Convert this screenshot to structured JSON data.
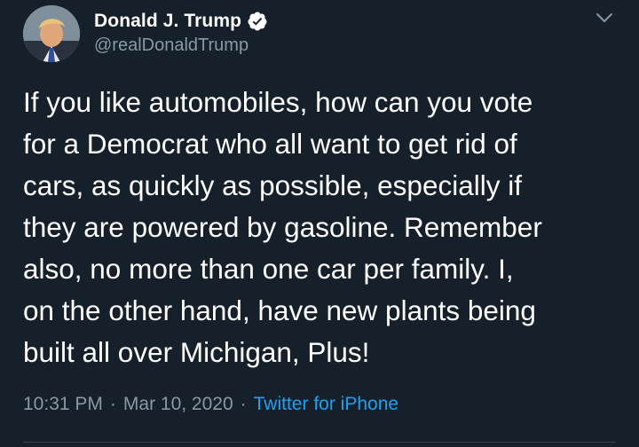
{
  "author": {
    "display_name": "Donald J. Trump",
    "handle": "@realDonaldTrump",
    "verified": true,
    "verified_icon": "verified-badge-icon",
    "avatar": "profile-avatar"
  },
  "tweet": {
    "text": "If you like automobiles, how can you vote\nfor a Democrat who all want to get rid of\ncars, as quickly as possible, especially if\nthey are powered by gasoline. Remember\nalso, no more than one car per family. I,\non the other hand, have new plants being\nbuilt all over Michigan, Plus!",
    "time": "10:31 PM",
    "date": "Mar 10, 2020",
    "separator": "·",
    "source": "Twitter for iPhone"
  },
  "menu": {
    "icon": "chevron-down-icon"
  },
  "colors": {
    "background": "#15202b",
    "text": "#ffffff",
    "secondary_text": "#8899a6",
    "accent": "#1da1f2",
    "divider": "#38444d"
  }
}
